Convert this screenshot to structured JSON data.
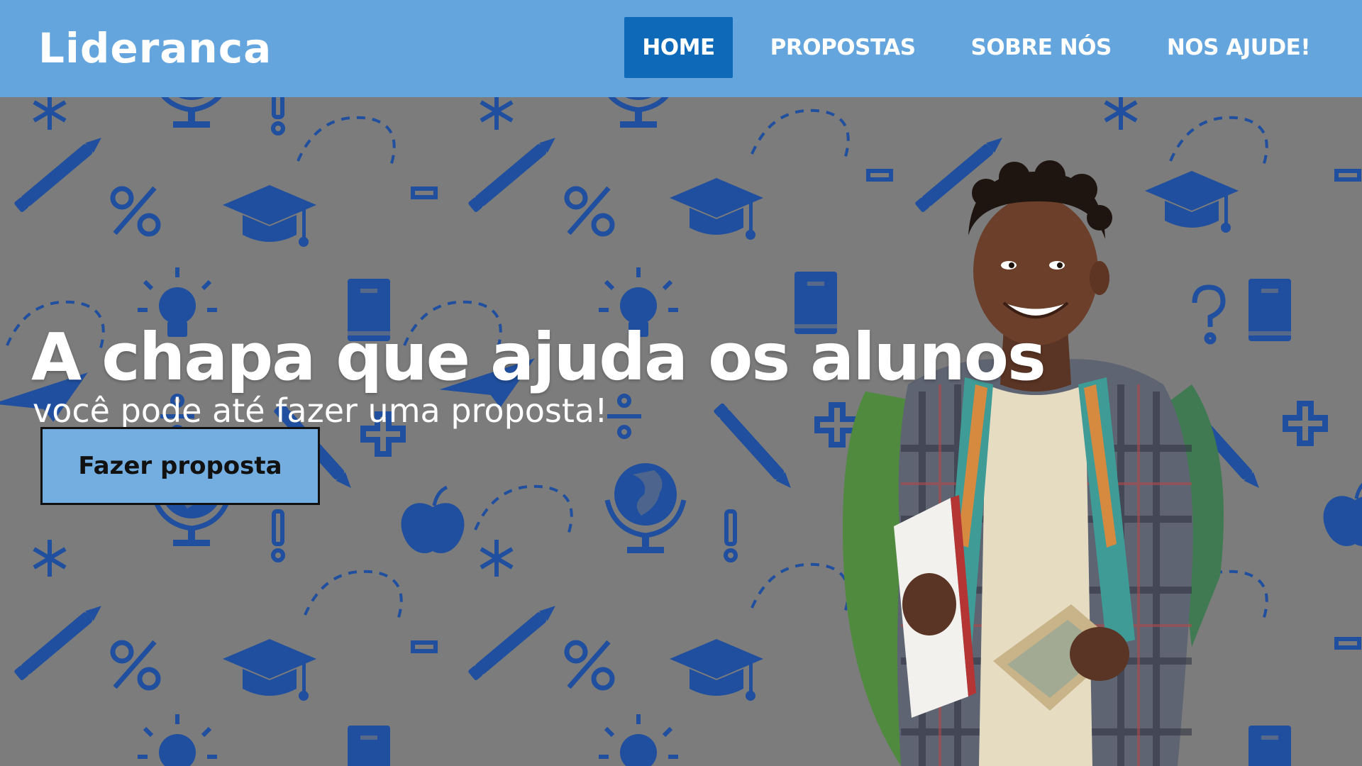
{
  "brand": "Lideranca",
  "nav": {
    "items": [
      {
        "label": "HOME",
        "active": true
      },
      {
        "label": "PROPOSTAS",
        "active": false
      },
      {
        "label": "SOBRE NÓS",
        "active": false
      },
      {
        "label": "NOS AJUDE!",
        "active": false
      }
    ]
  },
  "hero": {
    "headline": "A chapa que ajuda os alunos",
    "subline": "você pode até fazer uma proposta!",
    "cta_label": "Fazer proposta",
    "background_pattern_icons": [
      "pencil-icon",
      "graduation-cap-icon",
      "percent-icon",
      "globe-icon",
      "book-icon",
      "apple-icon",
      "lightbulb-icon",
      "question-mark-icon",
      "plus-icon",
      "divide-icon",
      "minus-icon",
      "exclamation-icon",
      "asterisk-icon",
      "paper-plane-icon"
    ]
  },
  "colors": {
    "navbar": "#64a5dd",
    "nav_active": "#0e69b8",
    "hero_background": "#7c7c7c",
    "pattern_icon": "#1f4f9e",
    "cta_background": "#74addf"
  }
}
